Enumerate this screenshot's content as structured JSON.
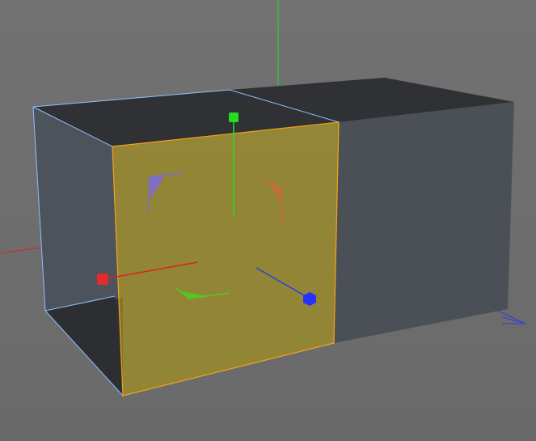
{
  "viewport": {
    "background": "#6f6f6f",
    "grid_line_color": "#7b7b7b"
  },
  "scene": {
    "objects": [
      {
        "name": "cube",
        "face_selection": {
          "selected_face_color": "#b19a1a",
          "selected_face_edge_color": "#f3a21c"
        },
        "box_colors": {
          "front_face": "#3a3d41",
          "side_face": "#4b5057",
          "top_face": "#2f3135",
          "selection_edge": "#8dc1ff"
        }
      }
    ]
  },
  "gizmo": {
    "x_axis_color": "#e02020",
    "y_axis_color": "#22dd22",
    "z_axis_color": "#2222ee",
    "x_handle_color": "#e52a2a",
    "y_handle_color": "#22dd22",
    "z_handle_color": "#2533ff",
    "rotation_x_color": "#7b6ad6",
    "rotation_y_color": "#d0683b",
    "rotation_z_color": "#4ccc24"
  }
}
